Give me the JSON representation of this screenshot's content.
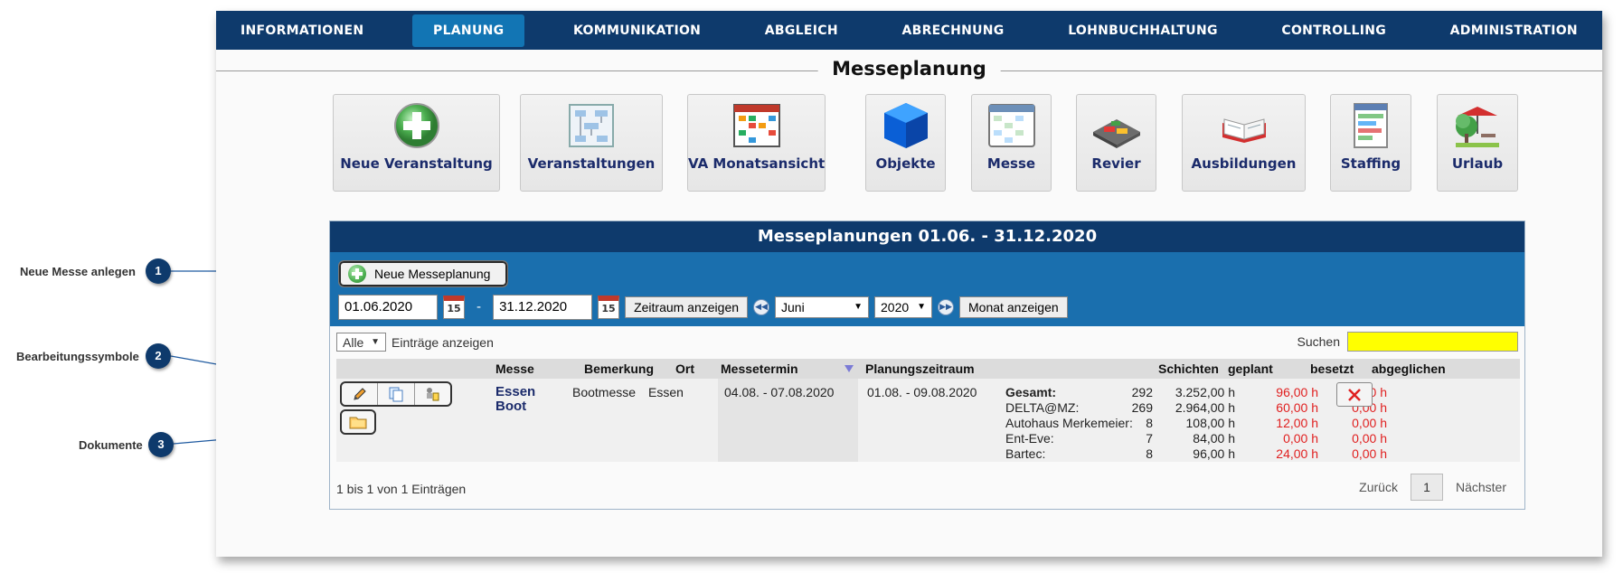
{
  "nav": {
    "items": [
      "INFORMATIONEN",
      "PLANUNG",
      "KOMMUNIKATION",
      "ABGLEICH",
      "ABRECHNUNG",
      "LOHNBUCHHALTUNG",
      "CONTROLLING",
      "ADMINISTRATION"
    ],
    "active": "PLANUNG"
  },
  "page": {
    "title": "Messeplanung"
  },
  "tiles": [
    {
      "label": "Neue Veranstaltung",
      "icon": "add-icon"
    },
    {
      "label": "Veranstaltungen",
      "icon": "flowchart-icon"
    },
    {
      "label": "VA Monatsansicht",
      "icon": "calendar-grid-icon"
    },
    {
      "label": "Objekte",
      "icon": "cube-icon"
    },
    {
      "label": "Messe",
      "icon": "schedule-icon"
    },
    {
      "label": "Revier",
      "icon": "map-cars-icon"
    },
    {
      "label": "Ausbildungen",
      "icon": "book-icon"
    },
    {
      "label": "Staffing",
      "icon": "staffing-chart-icon"
    },
    {
      "label": "Urlaub",
      "icon": "vacation-tree-icon"
    }
  ],
  "panel": {
    "title": "Messeplanungen 01.06. - 31.12.2020",
    "new_button": "Neue Messeplanung",
    "date_from": "01.06.2020",
    "date_sep": "-",
    "date_to": "31.12.2020",
    "calendar_day": "15",
    "show_range_button": "Zeitraum anzeigen",
    "month_value": "Juni",
    "year_value": "2020",
    "show_month_button": "Monat anzeigen"
  },
  "filter": {
    "entries_select": "Alle",
    "entries_label": "Einträge anzeigen",
    "search_label": "Suchen"
  },
  "table": {
    "headers": {
      "messe": "Messe",
      "bemerkung": "Bemerkung",
      "ort": "Ort",
      "messetermin": "Messetermin",
      "planungszeitraum": "Planungszeitraum",
      "schichten": "Schichten",
      "geplant": "geplant",
      "besetzt": "besetzt",
      "abgeglichen": "abgeglichen"
    },
    "row": {
      "messe_line1": "Essen",
      "messe_line2": "Boot",
      "bemerkung": "Bootmesse",
      "ort": "Essen",
      "messetermin": "04.08. - 07.08.2020",
      "planungszeitraum": "01.08. - 09.08.2020",
      "breakdown": [
        {
          "name": "Gesamt:",
          "schichten": "292",
          "geplant": "3.252,00 h",
          "besetzt": "96,00 h",
          "abgeglichen": "0,00 h"
        },
        {
          "name": "DELTA@MZ:",
          "schichten": "269",
          "geplant": "2.964,00 h",
          "besetzt": "60,00 h",
          "abgeglichen": "0,00 h"
        },
        {
          "name": "Autohaus Merkemeier:",
          "schichten": "8",
          "geplant": "108,00 h",
          "besetzt": "12,00 h",
          "abgeglichen": "0,00 h"
        },
        {
          "name": "Ent-Eve:",
          "schichten": "7",
          "geplant": "84,00 h",
          "besetzt": "0,00 h",
          "abgeglichen": "0,00 h"
        },
        {
          "name": "Bartec:",
          "schichten": "8",
          "geplant": "96,00 h",
          "besetzt": "24,00 h",
          "abgeglichen": "0,00 h"
        }
      ]
    },
    "info": "1 bis 1 von 1 Einträgen",
    "pager": {
      "prev": "Zurück",
      "page": "1",
      "next": "Nächster"
    }
  },
  "callouts": [
    {
      "number": "1",
      "label": "Neue Messe anlegen"
    },
    {
      "number": "2",
      "label": "Bearbeitungssymbole"
    },
    {
      "number": "3",
      "label": "Dokumente"
    }
  ],
  "colors": {
    "nav_bg": "#0e3a6c",
    "nav_active": "#1275b4",
    "toolbar_bg": "#1a6fae",
    "search_bg": "#ffff00",
    "red_values": "#e02020",
    "link": "#1b2b6b"
  }
}
